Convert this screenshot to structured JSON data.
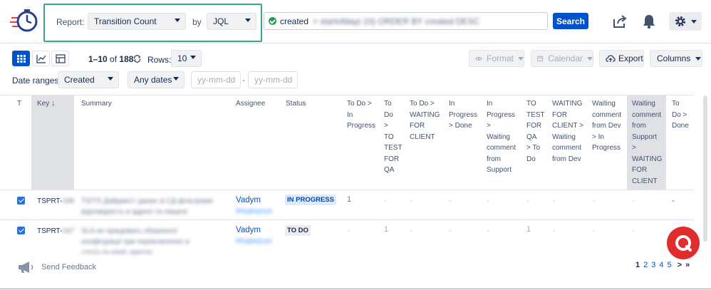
{
  "report": {
    "label": "Report:",
    "selected": "Transition Count",
    "by_label": "by",
    "by_selected": "JQL"
  },
  "query": {
    "prefix": "created",
    "rest": "> startofday(-10) ORDER BY created DESC",
    "search_label": "Search"
  },
  "toolbar": {
    "range_start": "1–10",
    "of": "of",
    "total": "188",
    "rows_label": "Rows:",
    "rows_value": "10",
    "format_label": "Format",
    "calendar_label": "Calendar",
    "export_label": "Export",
    "columns_label": "Columns"
  },
  "filters": {
    "date_ranges_label": "Date ranges:",
    "date_field": "Created",
    "date_preset": "Any dates",
    "from_placeholder": "yy-mm-dd",
    "separator": "-",
    "to_placeholder": "yy-mm-dd"
  },
  "table": {
    "headers": {
      "t": "T",
      "key": "Key",
      "summary": "Summary",
      "assignee": "Assignee",
      "status": "Status",
      "c1": [
        "To Do >",
        "In",
        "Progress"
      ],
      "c2": [
        "To",
        "Do",
        ">",
        "TO",
        "TEST",
        "FOR",
        "QA"
      ],
      "c3": [
        "To Do >",
        "WAITING",
        "FOR",
        "CLIENT"
      ],
      "c4": [
        "In",
        "Progress",
        "> Done"
      ],
      "c5": [
        "In",
        "Progress",
        ">",
        "Waiting",
        "comment",
        "from",
        "Support"
      ],
      "c6": [
        "TO",
        "TEST",
        "FOR",
        "QA",
        "> To",
        "Do"
      ],
      "c7": [
        "WAITING",
        "FOR",
        "CLIENT >",
        "Waiting",
        "comment",
        "from Dev"
      ],
      "c8": [
        "Waiting",
        "comment",
        "from Dev",
        "> In",
        "Progress"
      ],
      "c9": [
        "Waiting",
        "comment",
        "from",
        "Support",
        ">",
        "WAITING",
        "FOR",
        "CLIENT"
      ],
      "c10": [
        "To",
        "Do >",
        "Done"
      ]
    },
    "rows": [
      {
        "key": "TSPRT-",
        "key_suffix": "168",
        "summary_line1": "TS/TS Дайджест даних зі СД фільтрами",
        "summary_line2": "відповідність в адресі та нащені",
        "assignee_first": "Vadym",
        "assignee_last": "Медведчук",
        "status": "IN PROGRESS",
        "counts": [
          "1",
          "-",
          "-",
          "-",
          "-",
          "-",
          "-",
          "-",
          "-",
          "-"
        ]
      },
      {
        "key": "TSPRT-",
        "key_suffix": "167",
        "summary_line1": "SLA не працювать оберненої",
        "summary_line2": "конфігурації при переключенні зі",
        "summary_line3": "статусу на новий, адресою",
        "assignee_first": "Vadym",
        "assignee_last": "Медведчук",
        "status": "TO DO",
        "counts": [
          "-",
          "1",
          "-",
          "-",
          "-",
          "1",
          "-",
          "-",
          "-",
          ""
        ]
      }
    ]
  },
  "footer": {
    "feedback_label": "Send Feedback",
    "pages": [
      "1",
      "2",
      "3",
      "4",
      "5"
    ],
    "next": ">",
    "last": "»"
  },
  "colors": {
    "primary": "#0052cc",
    "highlight_border": "#3aa87a",
    "success": "#1f9d55",
    "status_in_progress_bg": "#deebff",
    "status_todo_bg": "#ebecf0",
    "help_button": "#e02c2c"
  }
}
